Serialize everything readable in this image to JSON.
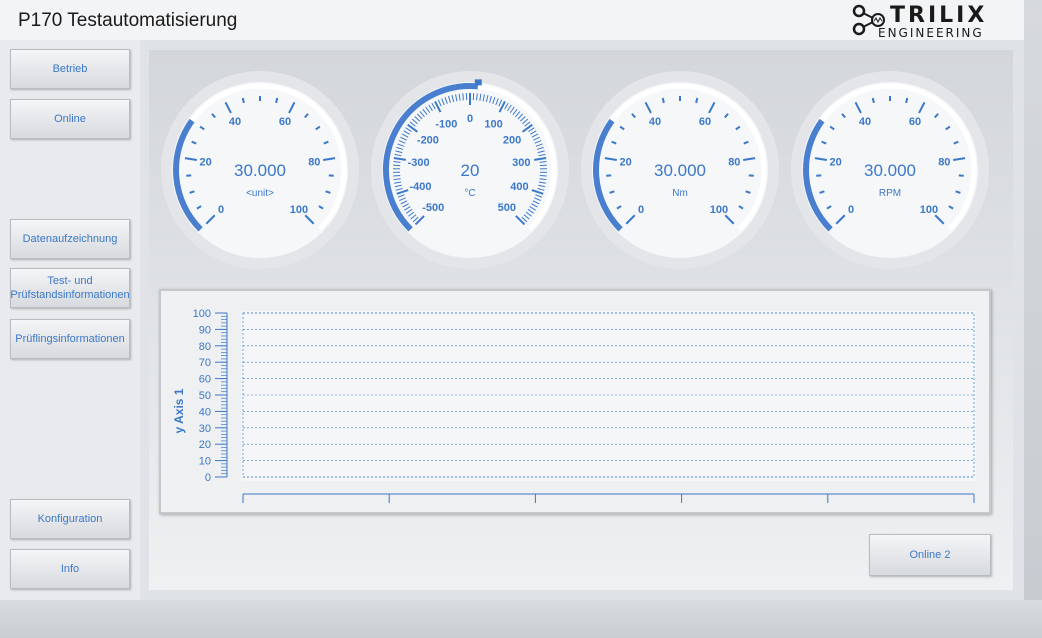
{
  "app": {
    "title": "P170 Testautomatisierung"
  },
  "logo": {
    "top": "TRILIX",
    "bottom": "ENGINEERING"
  },
  "nav": {
    "betrieb": "Betrieb",
    "online": "Online",
    "datenaufzeichnung": "Datenaufzeichnung",
    "test_line1": "Test- und",
    "test_line2": "Prüfstandsinformationen",
    "pruefling": "Prüflingsinformationen",
    "konfiguration": "Konfiguration",
    "info": "Info"
  },
  "gauges": [
    {
      "value": "30.000",
      "unit": "<unit>",
      "ticks": [
        "0",
        "20",
        "40",
        "60",
        "80",
        "100"
      ],
      "min": 0,
      "max": 100,
      "reading": 30
    },
    {
      "value": "20",
      "unit": "°C",
      "ticks": [
        "-500",
        "-400",
        "-300",
        "-200",
        "-100",
        "0",
        "100",
        "200",
        "300",
        "400",
        "500"
      ],
      "min": -500,
      "max": 500,
      "reading": 20
    },
    {
      "value": "30.000",
      "unit": "Nm",
      "ticks": [
        "0",
        "20",
        "40",
        "60",
        "80",
        "100"
      ],
      "min": 0,
      "max": 100,
      "reading": 30
    },
    {
      "value": "30.000",
      "unit": "RPM",
      "ticks": [
        "0",
        "20",
        "40",
        "60",
        "80",
        "100"
      ],
      "min": 0,
      "max": 100,
      "reading": 30
    }
  ],
  "chart_data": {
    "type": "line",
    "ylabel": "y Axis 1",
    "ylim": [
      0,
      100
    ],
    "yticks": [
      "0",
      "10",
      "20",
      "30",
      "40",
      "50",
      "60",
      "70",
      "80",
      "90",
      "100"
    ],
    "series": [],
    "grid": true
  },
  "buttons": {
    "online2": "Online 2"
  },
  "colors": {
    "accent": "#3b78c9",
    "gauge_arc": "#4a7fd0"
  }
}
